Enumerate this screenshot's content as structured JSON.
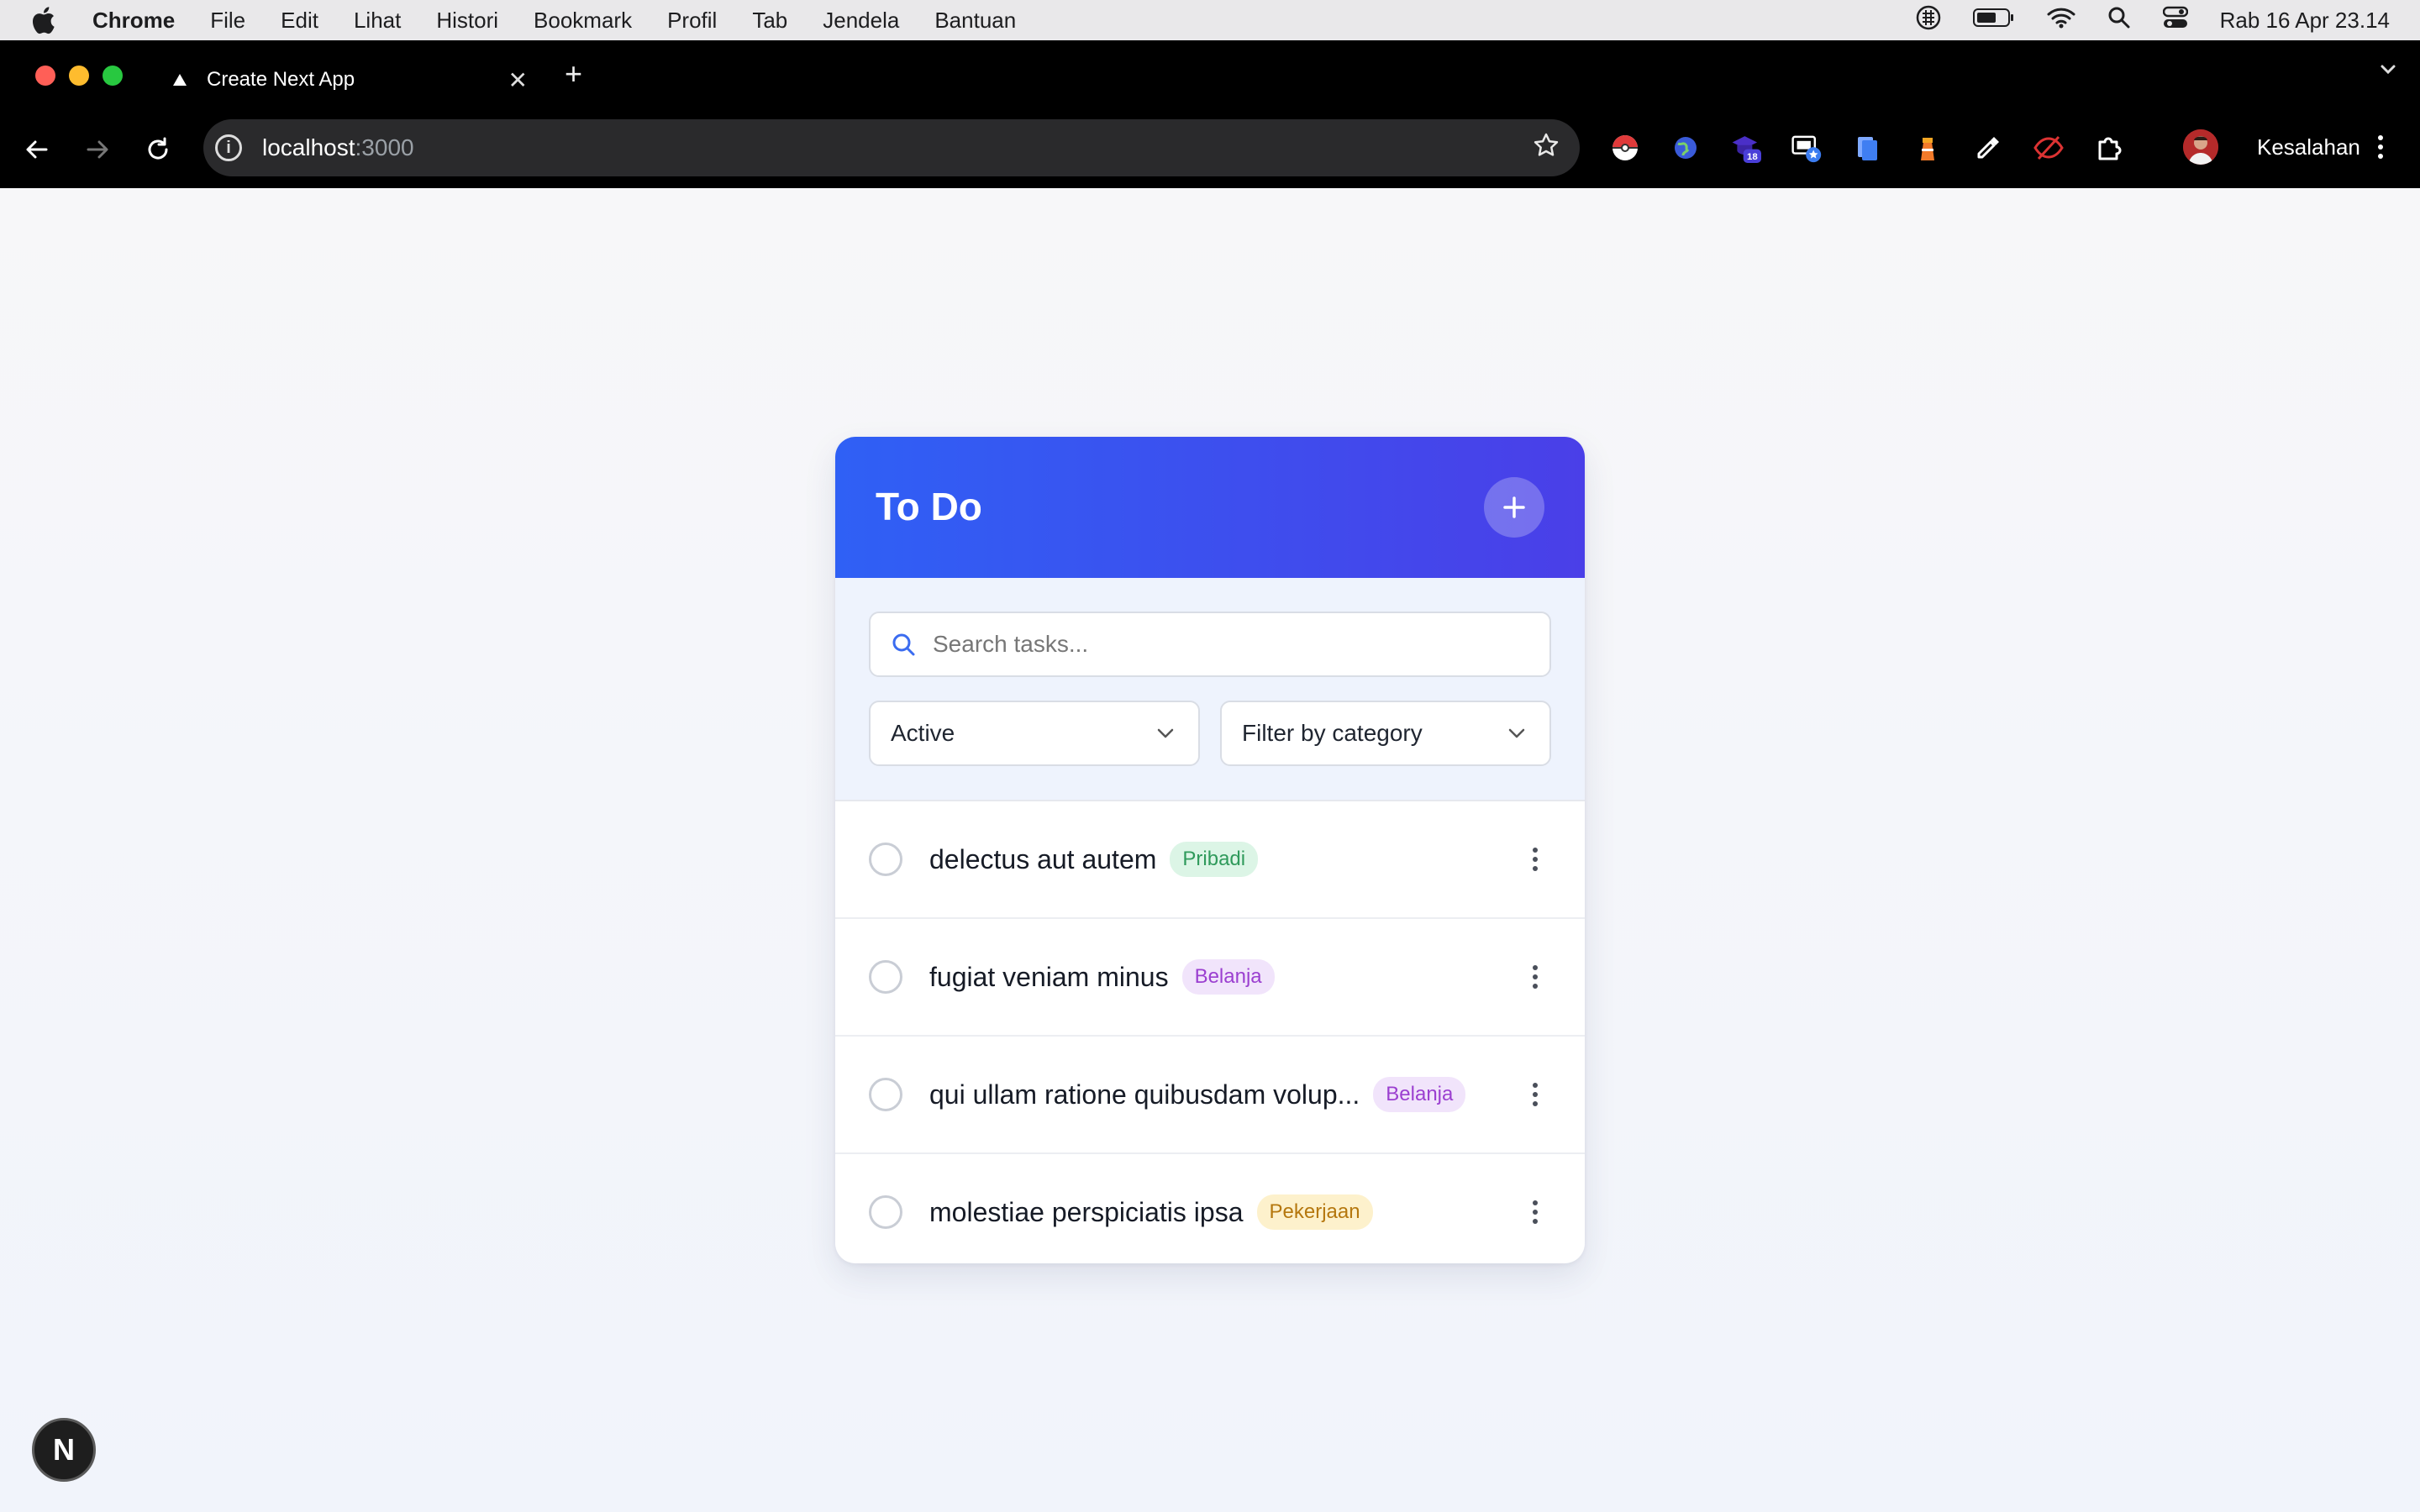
{
  "menubar": {
    "app": "Chrome",
    "items": [
      "File",
      "Edit",
      "Lihat",
      "Histori",
      "Bookmark",
      "Profil",
      "Tab",
      "Jendela",
      "Bantuan"
    ],
    "clock": "Rab 16 Apr  23.14"
  },
  "browser": {
    "tab_title": "Create Next App",
    "url_host": "localhost",
    "url_port": ":3000",
    "extension_badge": "18",
    "profile_label": "Kesalahan"
  },
  "app": {
    "title": "To Do",
    "search_placeholder": "Search tasks...",
    "status_filter": "Active",
    "category_filter": "Filter by category",
    "tasks": [
      {
        "title": "delectus aut autem",
        "category": "Pribadi"
      },
      {
        "title": "fugiat veniam minus",
        "category": "Belanja"
      },
      {
        "title": "qui ullam ratione quibusdam volup...",
        "category": "Belanja"
      },
      {
        "title": "molestiae perspiciatis ipsa",
        "category": "Pekerjaan"
      }
    ],
    "category_colors": {
      "Pribadi": {
        "bg": "#dcf5e6",
        "fg": "#2f9a5b"
      },
      "Belanja": {
        "bg": "#f1e4fb",
        "fg": "#9b3fd0"
      },
      "Pekerjaan": {
        "bg": "#fdf1cc",
        "fg": "#b5770e"
      }
    },
    "header_gradient": [
      "#2f60f5",
      "#4a3fe8"
    ]
  },
  "dev_badge": "N"
}
